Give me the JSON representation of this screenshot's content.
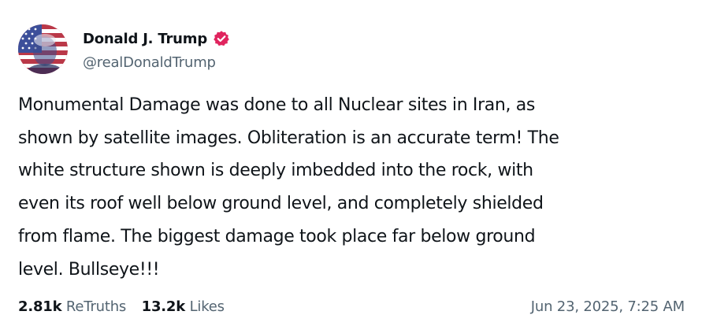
{
  "author": {
    "display_name": "Donald J. Trump",
    "handle": "@realDonaldTrump",
    "avatar_icon": "flag-portrait-avatar",
    "verified_icon": "verified-badge-icon",
    "verified_color": "#e0245e"
  },
  "post": {
    "lines": [
      "Monumental Damage was done to all Nuclear sites in Iran, as",
      "shown by satellite images. Obliteration is an accurate term! The",
      "white structure shown is deeply imbedded into the rock, with",
      "even its roof well below ground level, and completely shielded",
      "from flame. The biggest damage took place far below ground",
      "level. Bullseye!!!"
    ]
  },
  "stats": {
    "retruths_count": "2.81k",
    "retruths_label": "ReTruths",
    "likes_count": "13.2k",
    "likes_label": "Likes"
  },
  "timestamp": "Jun 23, 2025, 7:25 AM",
  "colors": {
    "text_primary": "#0f1419",
    "text_secondary": "#536471"
  }
}
